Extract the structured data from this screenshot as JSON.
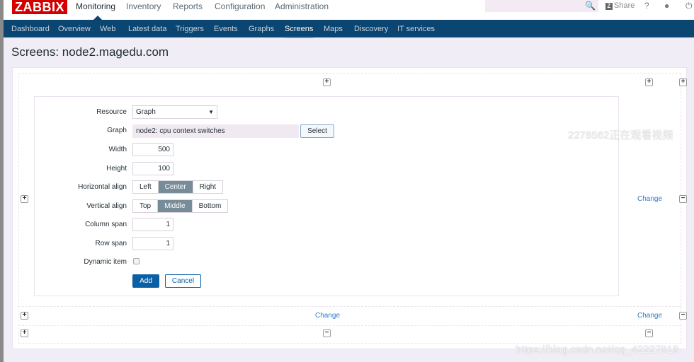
{
  "header": {
    "logo": "ZABBIX",
    "menu": [
      "Monitoring",
      "Inventory",
      "Reports",
      "Configuration",
      "Administration"
    ],
    "active_menu": "Monitoring",
    "share_label": "Share",
    "help": "?",
    "icons": [
      "search-icon",
      "share-icon",
      "help-icon",
      "user-icon",
      "power-icon"
    ]
  },
  "subnav": {
    "items": [
      "Dashboard",
      "Overview",
      "Web",
      "Latest data",
      "Triggers",
      "Events",
      "Graphs",
      "Screens",
      "Maps",
      "Discovery",
      "IT services"
    ],
    "active": "Screens"
  },
  "page": {
    "title": "Screens: node2.magedu.com"
  },
  "form": {
    "resource_label": "Resource",
    "resource_value": "Graph",
    "graph_label": "Graph",
    "graph_value": "node2: cpu context switches",
    "select_label": "Select",
    "width_label": "Width",
    "width_value": "500",
    "height_label": "Height",
    "height_value": "100",
    "halign_label": "Horizontal align",
    "halign_options": [
      "Left",
      "Center",
      "Right"
    ],
    "halign_selected": "Center",
    "valign_label": "Vertical align",
    "valign_options": [
      "Top",
      "Middle",
      "Bottom"
    ],
    "valign_selected": "Middle",
    "colspan_label": "Column span",
    "colspan_value": "1",
    "rowspan_label": "Row span",
    "rowspan_value": "1",
    "dynamic_label": "Dynamic item",
    "dynamic_checked": false,
    "add_label": "Add",
    "cancel_label": "Cancel"
  },
  "grid": {
    "change_label": "Change"
  },
  "watermarks": [
    "2278562正在观看视频",
    "https://blog.csdn.net/qq_42227818"
  ],
  "colors": {
    "brand": "#d40000",
    "nav": "#0b4572",
    "accent": "#0b5fa5",
    "link": "#2f7ac5",
    "selected_segment": "#768d99"
  }
}
